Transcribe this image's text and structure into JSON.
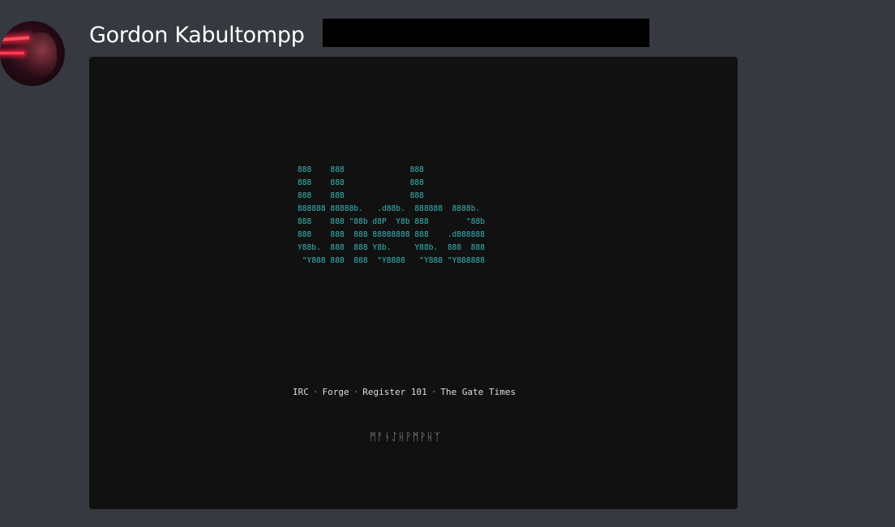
{
  "message": {
    "author": "Gordon Kabultompp"
  },
  "embed": {
    "ascii_art": "888    888              888\n888    888              888\n888    888              888\n888888 88888b.   .d88b.  888888  8888b.\n888    888 \"88b d8P  Y8b 888        \"88b\n888    888  888 88888888 888    .d888888\nY88b.  888  888 Y8b.     Y88b.  888  888\n \"Y888 888  888  \"Y8888   \"Y888 \"Y888888",
    "links": [
      "IRC",
      "Forge",
      "Register 101",
      "The Gate Times"
    ],
    "separator": "·",
    "runes": "ᛗᚨᚾᛇᚺᚹᛗᚹᚺᛉ"
  },
  "icons": {
    "avatar": "user-avatar"
  }
}
